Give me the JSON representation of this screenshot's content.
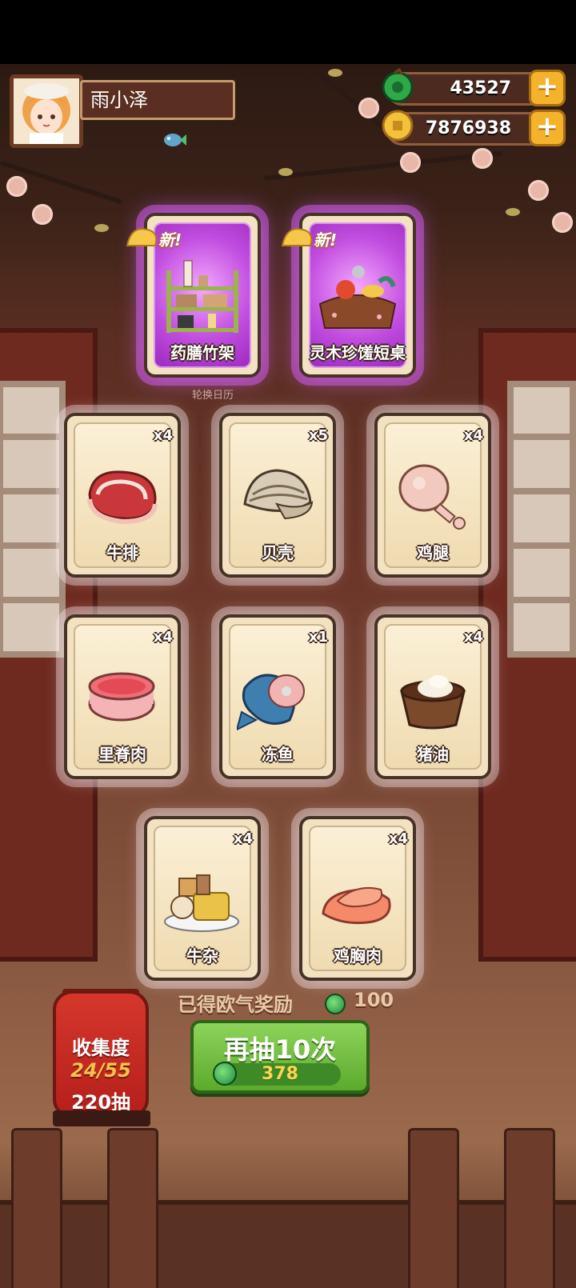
{
  "player": {
    "name": "雨小泽"
  },
  "currency": {
    "gems": "43527",
    "coins": "7876938",
    "plus_symbol": "+"
  },
  "new_badge": "新!",
  "calendar_label": "轮换日历",
  "cards": [
    {
      "label": "药膳竹架",
      "count": "",
      "rarity": "purple",
      "is_new": true
    },
    {
      "label": "灵木珍馐短桌",
      "count": "",
      "rarity": "purple",
      "is_new": true
    },
    {
      "label": "牛排",
      "count": "x4",
      "rarity": "normal"
    },
    {
      "label": "贝壳",
      "count": "x5",
      "rarity": "normal"
    },
    {
      "label": "鸡腿",
      "count": "x4",
      "rarity": "normal"
    },
    {
      "label": "里脊肉",
      "count": "x4",
      "rarity": "normal"
    },
    {
      "label": "冻鱼",
      "count": "x1",
      "rarity": "normal"
    },
    {
      "label": "猪油",
      "count": "x4",
      "rarity": "normal"
    },
    {
      "label": "牛杂",
      "count": "x4",
      "rarity": "normal"
    },
    {
      "label": "鸡胸肉",
      "count": "x4",
      "rarity": "normal"
    }
  ],
  "reward": {
    "text": "已得欧气奖励",
    "value": "100"
  },
  "collection": {
    "title": "收集度",
    "progress": "24/55",
    "draws": "220抽"
  },
  "draw_button": {
    "label": "再抽10次",
    "cost": "378"
  },
  "colors": {
    "gem": "#2fa84a",
    "coin": "#f2c23b",
    "button_green": "#6fbd3e",
    "purple_glow": "#c24ee0"
  }
}
